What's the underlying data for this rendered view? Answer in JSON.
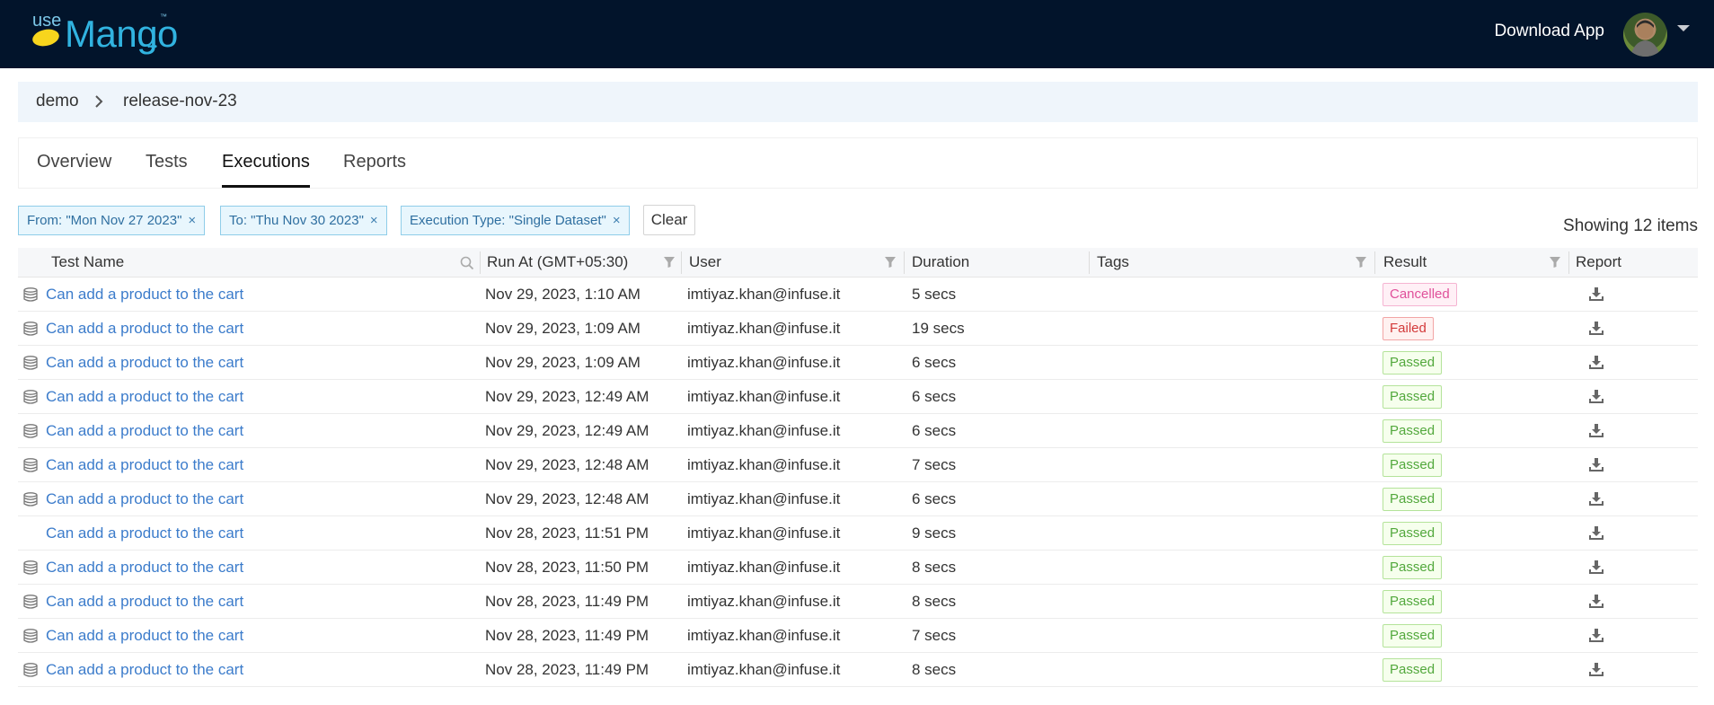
{
  "header": {
    "logo_use": "use",
    "logo_mango": "Mango",
    "logo_tm": "™",
    "download_app": "Download App",
    "icons": {
      "avatar": "user-avatar",
      "dropdown": "caret-down-icon"
    }
  },
  "breadcrumb": {
    "items": [
      "demo",
      "release-nov-23"
    ]
  },
  "tabs": [
    {
      "label": "Overview",
      "active": false
    },
    {
      "label": "Tests",
      "active": false
    },
    {
      "label": "Executions",
      "active": true
    },
    {
      "label": "Reports",
      "active": false
    }
  ],
  "filters": {
    "chips": [
      {
        "label": "From: \"Mon Nov 27 2023\""
      },
      {
        "label": "To: \"Thu Nov 30 2023\""
      },
      {
        "label": "Execution Type: \"Single Dataset\""
      }
    ],
    "close_glyph": "×",
    "clear_label": "Clear",
    "showing": "Showing 12 items"
  },
  "table": {
    "columns": [
      "Test Name",
      "Run At (GMT+05:30)",
      "User",
      "Duration",
      "Tags",
      "Result",
      "Report"
    ],
    "rows": [
      {
        "name": "Can add a product to the cart",
        "run_at": "Nov 29, 2023, 1:10 AM",
        "user": "imtiyaz.khan@infuse.it",
        "duration": "5 secs",
        "result": "Cancelled",
        "db_icon": true
      },
      {
        "name": "Can add a product to the cart",
        "run_at": "Nov 29, 2023, 1:09 AM",
        "user": "imtiyaz.khan@infuse.it",
        "duration": "19 secs",
        "result": "Failed",
        "db_icon": true
      },
      {
        "name": "Can add a product to the cart",
        "run_at": "Nov 29, 2023, 1:09 AM",
        "user": "imtiyaz.khan@infuse.it",
        "duration": "6 secs",
        "result": "Passed",
        "db_icon": true
      },
      {
        "name": "Can add a product to the cart",
        "run_at": "Nov 29, 2023, 12:49 AM",
        "user": "imtiyaz.khan@infuse.it",
        "duration": "6 secs",
        "result": "Passed",
        "db_icon": true
      },
      {
        "name": "Can add a product to the cart",
        "run_at": "Nov 29, 2023, 12:49 AM",
        "user": "imtiyaz.khan@infuse.it",
        "duration": "6 secs",
        "result": "Passed",
        "db_icon": true
      },
      {
        "name": "Can add a product to the cart",
        "run_at": "Nov 29, 2023, 12:48 AM",
        "user": "imtiyaz.khan@infuse.it",
        "duration": "7 secs",
        "result": "Passed",
        "db_icon": true
      },
      {
        "name": "Can add a product to the cart",
        "run_at": "Nov 29, 2023, 12:48 AM",
        "user": "imtiyaz.khan@infuse.it",
        "duration": "6 secs",
        "result": "Passed",
        "db_icon": true
      },
      {
        "name": "Can add a product to the cart",
        "run_at": "Nov 28, 2023, 11:51 PM",
        "user": "imtiyaz.khan@infuse.it",
        "duration": "9 secs",
        "result": "Passed",
        "db_icon": false
      },
      {
        "name": "Can add a product to the cart",
        "run_at": "Nov 28, 2023, 11:50 PM",
        "user": "imtiyaz.khan@infuse.it",
        "duration": "8 secs",
        "result": "Passed",
        "db_icon": true
      },
      {
        "name": "Can add a product to the cart",
        "run_at": "Nov 28, 2023, 11:49 PM",
        "user": "imtiyaz.khan@infuse.it",
        "duration": "8 secs",
        "result": "Passed",
        "db_icon": true
      },
      {
        "name": "Can add a product to the cart",
        "run_at": "Nov 28, 2023, 11:49 PM",
        "user": "imtiyaz.khan@infuse.it",
        "duration": "7 secs",
        "result": "Passed",
        "db_icon": true
      },
      {
        "name": "Can add a product to the cart",
        "run_at": "Nov 28, 2023, 11:49 PM",
        "user": "imtiyaz.khan@infuse.it",
        "duration": "8 secs",
        "result": "Passed",
        "db_icon": true
      }
    ]
  },
  "colors": {
    "topbar": "#02142b",
    "link": "#3c7ccb",
    "passed": "#52a83c",
    "failed": "#d33a3a",
    "cancelled": "#e0509a"
  }
}
